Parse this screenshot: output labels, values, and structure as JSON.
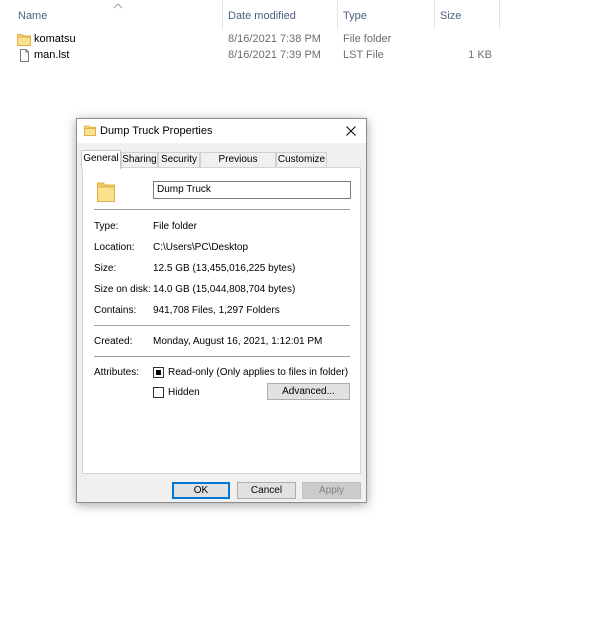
{
  "explorer": {
    "columns": {
      "name": "Name",
      "date": "Date modified",
      "type": "Type",
      "size": "Size"
    },
    "rows": [
      {
        "name": "komatsu",
        "date": "8/16/2021 7:38 PM",
        "type": "File folder",
        "size": "",
        "icon": "folder-icon"
      },
      {
        "name": "man.lst",
        "date": "8/16/2021 7:39 PM",
        "type": "LST File",
        "size": "1 KB",
        "icon": "file-icon"
      }
    ]
  },
  "dialog": {
    "title": "Dump Truck Properties",
    "tabs": [
      "General",
      "Sharing",
      "Security",
      "Previous Versions",
      "Customize"
    ],
    "active_tab": "General",
    "name_value": "Dump Truck",
    "fields": {
      "type_label": "Type:",
      "type_value": "File folder",
      "location_label": "Location:",
      "location_value": "C:\\Users\\PC\\Desktop",
      "size_label": "Size:",
      "size_value": "12.5 GB (13,455,016,225 bytes)",
      "size_on_disk_label": "Size on disk:",
      "size_on_disk_value": "14.0 GB (15,044,808,704 bytes)",
      "contains_label": "Contains:",
      "contains_value": "941,708 Files, 1,297 Folders",
      "created_label": "Created:",
      "created_value": "Monday, August 16, 2021, 1:12:01 PM",
      "attributes_label": "Attributes:"
    },
    "attributes": {
      "readonly_label": "Read-only (Only applies to files in folder)",
      "readonly_state": "indeterminate",
      "hidden_label": "Hidden",
      "hidden_checked": false,
      "advanced_label": "Advanced..."
    },
    "buttons": {
      "ok": "OK",
      "cancel": "Cancel",
      "apply": "Apply"
    },
    "colors": {
      "folder": "#f8d775",
      "folder_dark": "#e6b84c",
      "accent": "#0078d7"
    }
  }
}
